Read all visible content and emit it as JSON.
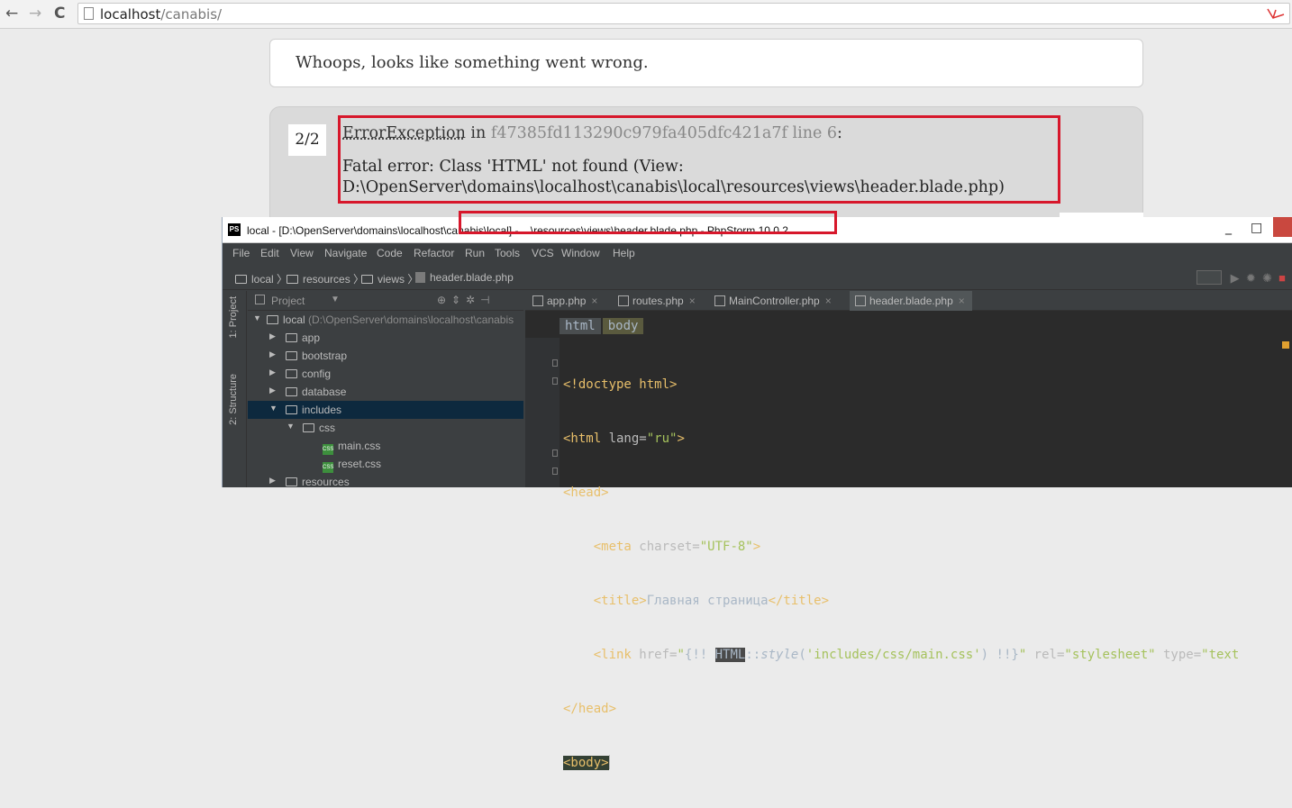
{
  "browser": {
    "back": "←",
    "forward": "→",
    "reload": "C",
    "url_host": "localhost",
    "url_path": "/canabis/"
  },
  "whoops": {
    "message": "Whoops, looks like something went wrong.",
    "counter": "2/2",
    "exception_class": "ErrorException",
    "in_word": " in ",
    "file": "f47385fd113290c979fa405dfc421a7f line 6",
    "colon": ":",
    "error_line1": "Fatal error: Class 'HTML' not found (View:",
    "error_line2": "D:\\OpenServer\\domains\\localhost\\canabis\\local\\resources\\views\\header.blade.php)"
  },
  "ide": {
    "window_title": "local - [D:\\OpenServer\\domains\\localhost\\canabis\\local] - ...\\resources\\views\\header.blade.php - PhpStorm 10.0.2",
    "logo": "PS",
    "menu": [
      "File",
      "Edit",
      "View",
      "Navigate",
      "Code",
      "Refactor",
      "Run",
      "Tools",
      "VCS",
      "Window",
      "Help"
    ],
    "breadcrumbs": [
      "local",
      "resources",
      "views",
      "header.blade.php"
    ],
    "side_tabs": [
      "1: Project",
      "2: Structure"
    ],
    "project_panel_label": "Project",
    "tree": [
      {
        "label": "local",
        "hint": " (D:\\OpenServer\\domains\\localhost\\canabis"
      },
      {
        "label": "app"
      },
      {
        "label": "bootstrap"
      },
      {
        "label": "config"
      },
      {
        "label": "database"
      },
      {
        "label": "includes"
      },
      {
        "label": "css"
      },
      {
        "label": "main.css"
      },
      {
        "label": "reset.css"
      },
      {
        "label": "resources"
      }
    ],
    "editor_tabs": [
      "app.php",
      "routes.php",
      "MainController.php",
      "header.blade.php"
    ],
    "breadcrumb_tags": [
      "html",
      "body"
    ],
    "code": {
      "l1": "<!doctype html>",
      "l2_tag": "<html ",
      "l2_attr": "lang=",
      "l2_val": "\"ru\"",
      "l2_end": ">",
      "l3": "<head>",
      "l4_tag": "    <meta ",
      "l4_attr": "charset=",
      "l4_val": "\"UTF-8\"",
      "l4_end": ">",
      "l5_open": "    <title>",
      "l5_text": "Главная страница",
      "l5_close": "</title>",
      "l6_tag": "    <link ",
      "l6_attr": "href=",
      "l6_q1": "\"",
      "l6_b1": "{!! ",
      "l6_cls": "HTML",
      "l6_sep": "::",
      "l6_fn": "style",
      "l6_p1": "(",
      "l6_arg": "'includes/css/main.css'",
      "l6_p2": ") !!}",
      "l6_q2": "\"",
      "l6_attr2": " rel=",
      "l6_val2": "\"stylesheet\"",
      "l6_attr3": " type=",
      "l6_val3": "\"text",
      "l7": "</head>",
      "l8": "<body>"
    }
  }
}
